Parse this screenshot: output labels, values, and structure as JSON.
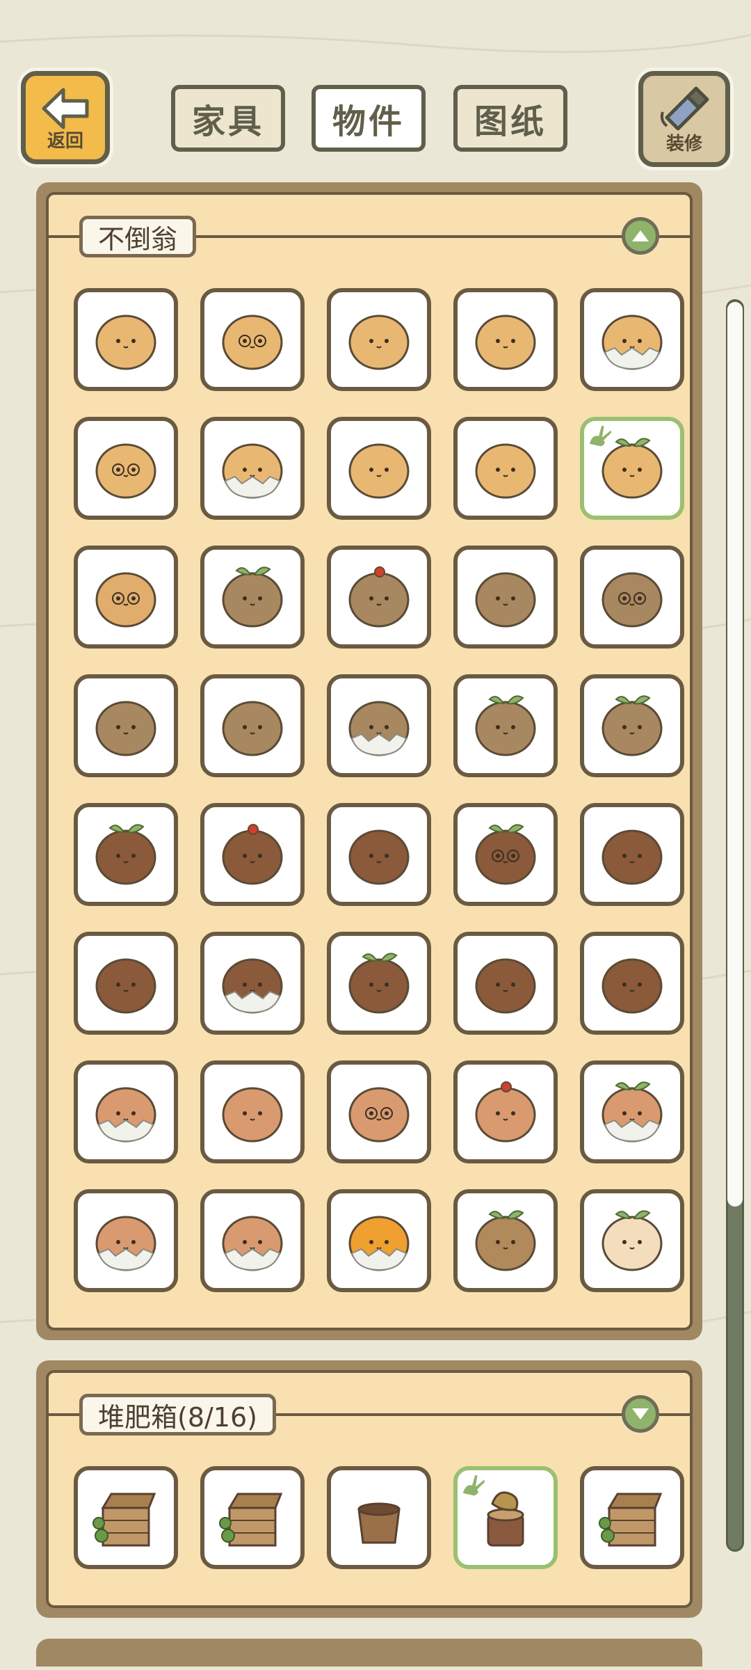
{
  "header": {
    "back_label": "返回",
    "tabs": [
      {
        "label": "家具",
        "active": false
      },
      {
        "label": "物件",
        "active": true
      },
      {
        "label": "图纸",
        "active": false
      }
    ],
    "decorate_label": "装修"
  },
  "sections": [
    {
      "title": "不倒翁",
      "expanded": true,
      "toggle_icon": "chevron-up-icon",
      "items": [
        {
          "icon": "tumbler-plain",
          "body": "#e8b872",
          "selected": false
        },
        {
          "icon": "tumbler-owl",
          "body": "#e8b872",
          "selected": false
        },
        {
          "icon": "tumbler-burger",
          "body": "#e8b872",
          "selected": false
        },
        {
          "icon": "tumbler-raccoon",
          "body": "#e8b872",
          "selected": false
        },
        {
          "icon": "tumbler-eggshell",
          "body": "#e8b872",
          "selected": false
        },
        {
          "icon": "tumbler-glasses",
          "body": "#e8b872",
          "selected": false
        },
        {
          "icon": "tumbler-shell-bird",
          "body": "#e8b872",
          "selected": false
        },
        {
          "icon": "tumbler-wink",
          "body": "#e8b872",
          "selected": false
        },
        {
          "icon": "tumbler-grumpy",
          "body": "#e8b872",
          "selected": false
        },
        {
          "icon": "tumbler-sprout",
          "body": "#e8b872",
          "selected": true
        },
        {
          "icon": "tumbler-bowl",
          "body": "#e0ad6c",
          "selected": false
        },
        {
          "icon": "chestnut-leaf",
          "body": "#a88860",
          "selected": false
        },
        {
          "icon": "chestnut-cherry",
          "body": "#a88860",
          "selected": false
        },
        {
          "icon": "chestnut-grumpy",
          "body": "#a88860",
          "selected": false
        },
        {
          "icon": "chestnut-owl",
          "body": "#a88860",
          "selected": false
        },
        {
          "icon": "chestnut-sleepy",
          "body": "#a88860",
          "selected": false
        },
        {
          "icon": "chestnut-bird",
          "body": "#a88860",
          "selected": false
        },
        {
          "icon": "chestnut-shell",
          "body": "#a88860",
          "selected": false
        },
        {
          "icon": "chestnut-sprout-dog",
          "body": "#a88860",
          "selected": false
        },
        {
          "icon": "chestnut-leaf-cap",
          "body": "#a88860",
          "selected": false
        },
        {
          "icon": "acorn-leaf",
          "body": "#8a5a3a",
          "selected": false
        },
        {
          "icon": "acorn-cherry",
          "body": "#8a5a3a",
          "selected": false
        },
        {
          "icon": "acorn-plain",
          "body": "#8a5a3a",
          "selected": false
        },
        {
          "icon": "acorn-sprout-glasses",
          "body": "#8a5a3a",
          "selected": false
        },
        {
          "icon": "acorn-smile",
          "body": "#8a5a3a",
          "selected": false
        },
        {
          "icon": "acorn-bun",
          "body": "#8a5a3a",
          "selected": false
        },
        {
          "icon": "acorn-eggshell",
          "body": "#8a5a3a",
          "selected": false
        },
        {
          "icon": "acorn-sprout",
          "body": "#8a5a3a",
          "selected": false
        },
        {
          "icon": "acorn-sleepy",
          "body": "#8a5a3a",
          "selected": false
        },
        {
          "icon": "acorn-antenna",
          "body": "#8a5a3a",
          "selected": false
        },
        {
          "icon": "peach-shell",
          "body": "#d99a70",
          "selected": false
        },
        {
          "icon": "peach-lashes",
          "body": "#d99a70",
          "selected": false
        },
        {
          "icon": "peach-glasses",
          "body": "#d99a70",
          "selected": false
        },
        {
          "icon": "peach-cherry-monkey",
          "body": "#d99a70",
          "selected": false
        },
        {
          "icon": "peach-leaf-shell",
          "body": "#d99a70",
          "selected": false
        },
        {
          "icon": "peach-eggshell",
          "body": "#d99a70",
          "selected": false
        },
        {
          "icon": "peach-shell-smile",
          "body": "#d99a70",
          "selected": false
        },
        {
          "icon": "orange-bird-shell",
          "body": "#f0a030",
          "selected": false
        },
        {
          "icon": "brown-leaf-frame",
          "body": "#b08a5a",
          "selected": false
        },
        {
          "icon": "onion-sprout",
          "body": "#f4ddbc",
          "selected": false
        }
      ]
    },
    {
      "title": "堆肥箱(8/16)",
      "expanded": false,
      "toggle_icon": "chevron-down-icon",
      "items": [
        {
          "icon": "compost-box-ivy",
          "selected": false
        },
        {
          "icon": "compost-crate",
          "selected": false
        },
        {
          "icon": "compost-tub",
          "selected": false
        },
        {
          "icon": "compost-stump",
          "selected": true
        },
        {
          "icon": "compost-box-ivy-open",
          "selected": false
        }
      ]
    }
  ],
  "colors": {
    "accent_green": "#9ac070",
    "panel_wood": "#a08862",
    "panel_fill": "#f9e0b1",
    "back_button": "#f2bb4a"
  }
}
